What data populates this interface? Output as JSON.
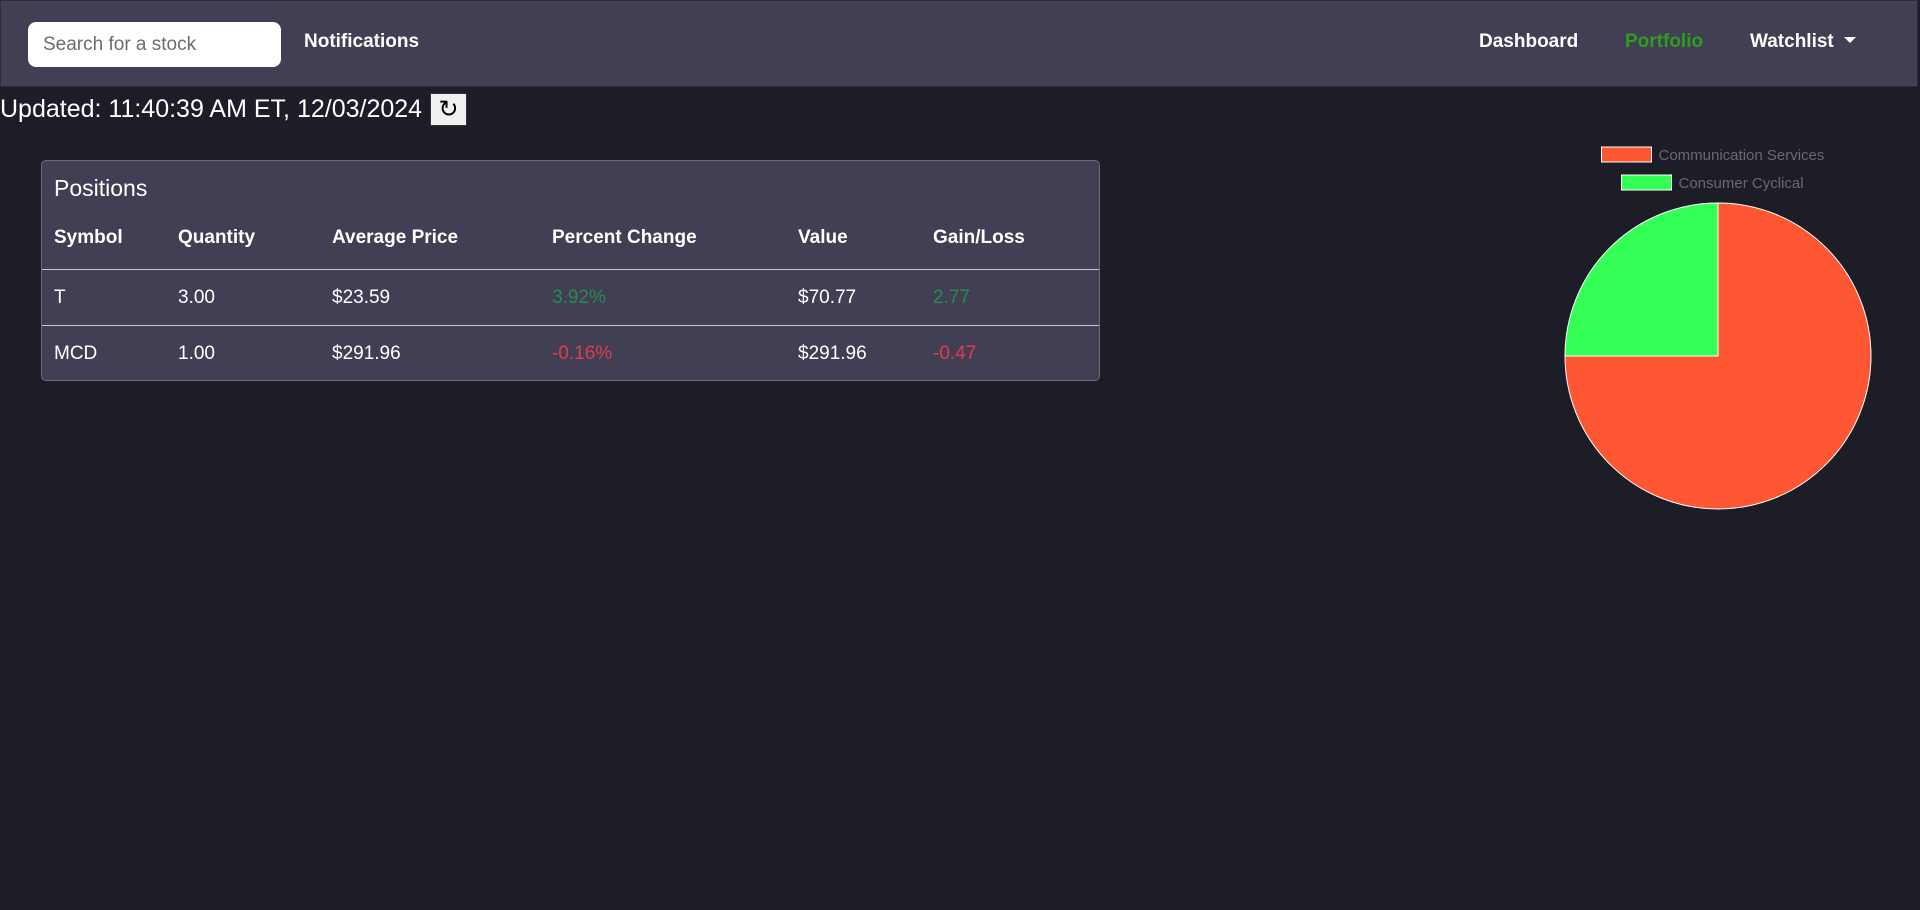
{
  "navbar": {
    "search_placeholder": "Search for a stock",
    "notifications": "Notifications",
    "dashboard": "Dashboard",
    "portfolio": "Portfolio",
    "watchlist": "Watchlist"
  },
  "status": {
    "updated": "Updated: 11:40:39 AM ET, 12/03/2024",
    "refresh_icon": "↻"
  },
  "positions": {
    "title": "Positions",
    "columns": [
      "Symbol",
      "Quantity",
      "Average Price",
      "Percent Change",
      "Value",
      "Gain/Loss"
    ],
    "rows": [
      {
        "symbol": "T",
        "quantity": "3.00",
        "avg_price": "$23.59",
        "pct_change": "3.92%",
        "value": "$70.77",
        "gain_loss": "2.77"
      },
      {
        "symbol": "MCD",
        "quantity": "1.00",
        "avg_price": "$291.96",
        "pct_change": "-0.16%",
        "value": "$291.96",
        "gain_loss": "-0.47"
      }
    ]
  },
  "colors": {
    "accent_positive": "#2a8a4d",
    "accent_negative": "#e33b4d",
    "portfolio_active": "#2e9d1f"
  },
  "chart_data": {
    "type": "pie",
    "categories": [
      "Communication Services",
      "Consumer Cyclical"
    ],
    "values": [
      75,
      25
    ],
    "colors": [
      "#ff5733",
      "#33ff57"
    ],
    "legend": "top"
  }
}
